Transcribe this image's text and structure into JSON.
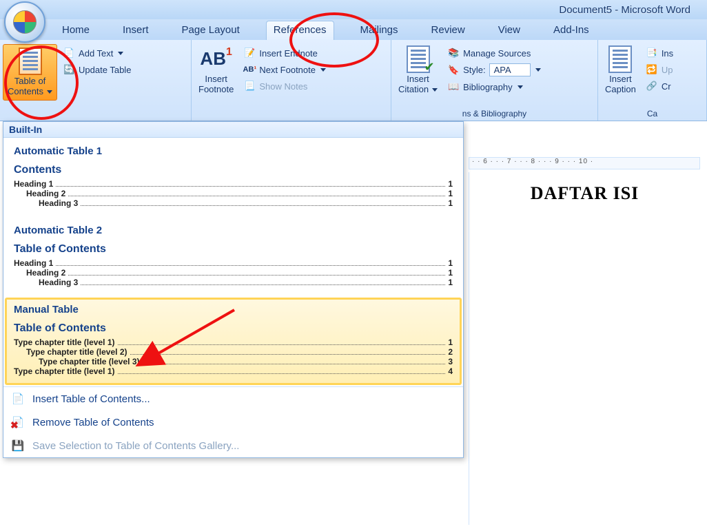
{
  "window": {
    "title": "Document5 - Microsoft Word"
  },
  "tabs": [
    "Home",
    "Insert",
    "Page Layout",
    "References",
    "Mailings",
    "Review",
    "View",
    "Add-Ins"
  ],
  "active_tab_index": 3,
  "ribbon": {
    "toc": {
      "big_label_line1": "Table of",
      "big_label_line2": "Contents",
      "add_text": "Add Text",
      "update_table": "Update Table"
    },
    "footnotes": {
      "insert_footnote_line1": "Insert",
      "insert_footnote_line2": "Footnote",
      "ab_label": "AB",
      "insert_endnote": "Insert Endnote",
      "next_footnote": "Next Footnote",
      "show_notes": "Show Notes"
    },
    "citations": {
      "insert_citation_line1": "Insert",
      "insert_citation_line2": "Citation",
      "manage_sources": "Manage Sources",
      "style_label": "Style:",
      "style_value": "APA",
      "bibliography": "Bibliography",
      "group_label": "ns & Bibliography"
    },
    "captions": {
      "insert_caption_line1": "Insert",
      "insert_caption_line2": "Caption",
      "ins": "Ins",
      "up": "Up",
      "cr": "Cr",
      "group_label": "Ca"
    }
  },
  "gallery": {
    "builtin_header": "Built-In",
    "items": [
      {
        "title": "Automatic Table 1",
        "preview_title": "Contents",
        "rows": [
          [
            "Heading 1",
            "1",
            0
          ],
          [
            "Heading 2",
            "1",
            1
          ],
          [
            "Heading 3",
            "1",
            2
          ]
        ]
      },
      {
        "title": "Automatic Table 2",
        "preview_title": "Table of Contents",
        "rows": [
          [
            "Heading 1",
            "1",
            0
          ],
          [
            "Heading 2",
            "1",
            1
          ],
          [
            "Heading 3",
            "1",
            2
          ]
        ]
      },
      {
        "title": "Manual Table",
        "preview_title": "Table of Contents",
        "rows": [
          [
            "Type chapter title (level 1)",
            "1",
            0
          ],
          [
            "Type chapter title (level 2)",
            "2",
            1
          ],
          [
            "Type chapter title (level 3)",
            "3",
            2
          ],
          [
            "Type chapter title (level 1)",
            "4",
            0
          ]
        ]
      }
    ],
    "hover_index": 2,
    "cmds": {
      "insert_toc": "Insert Table of Contents...",
      "remove_toc": "Remove Table of Contents",
      "save_selection": "Save Selection to Table of Contents Gallery..."
    }
  },
  "ruler_text": "· · 6 · · · 7 · · · 8 · · · 9 · · · 10 ·",
  "document": {
    "heading": "DAFTAR ISI"
  }
}
